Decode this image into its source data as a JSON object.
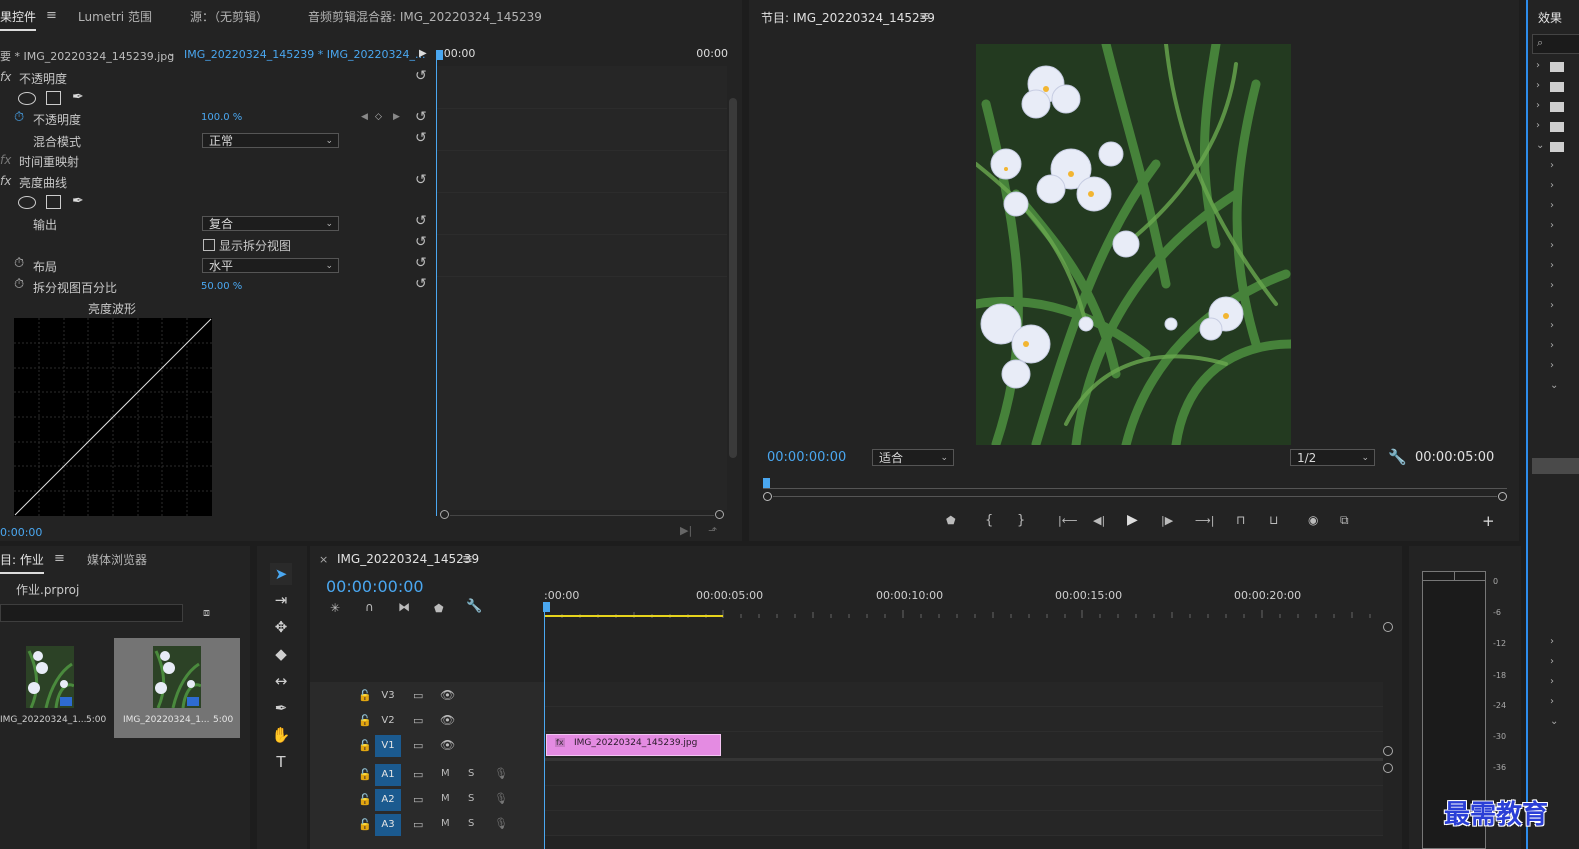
{
  "effect_controls": {
    "tab_effect": "果控件",
    "tab_lumetri": "Lumetri 范围",
    "tab_source": "源：（无剪辑）",
    "tab_audio": "音频剪辑混合器: IMG_20220324_145239",
    "menu_glyph": "≡",
    "master_clip": "要 * IMG_20220324_145239.jpg",
    "seq_clip": "IMG_20220324_145239 * IMG_20220324_...",
    "tc_start": ":00:00",
    "tc_end": "00:00",
    "fx_prefix": "fx",
    "opacity_group": "不透明度",
    "opacity_label": "不透明度",
    "opacity_value": "100.0 %",
    "blend_label": "混合模式",
    "blend_value": "正常",
    "time_remap": "时间重映射",
    "luma_curve": "亮度曲线",
    "output_label": "输出",
    "output_value": "复合",
    "split_view_label": "显示拆分视图",
    "layout_label": "布局",
    "layout_value": "水平",
    "split_pct_label": "拆分视图百分比",
    "split_pct_value": "50.00 %",
    "waveform_label": "亮度波形",
    "bottom_tc": "0:00:00"
  },
  "program_monitor": {
    "title": "节目: IMG_20220324_145239",
    "menu_glyph": "≡",
    "current_tc": "00:00:00:00",
    "fit_value": "适合",
    "res_value": "1/2",
    "duration_tc": "00:00:05:00",
    "photo_colors": {
      "bg": "#2c4226",
      "leaf": "#3f7a35",
      "flower": "#e8ecf7",
      "accent": "#f2b531"
    }
  },
  "effects_panel": {
    "title": "效果",
    "search_icon": "search-icon"
  },
  "project": {
    "tab_project": "目: 作业",
    "tab_media": "媒体浏览器",
    "menu_glyph": "≡",
    "project_file": "作业.prproj",
    "items": [
      {
        "name": "IMG_20220324_1...",
        "duration": "5:00",
        "selected": false
      },
      {
        "name": "IMG_20220324_1...",
        "duration": "5:00",
        "selected": true
      }
    ]
  },
  "timeline": {
    "close": "×",
    "title": "IMG_20220324_145239",
    "menu_glyph": "≡",
    "current_tc": "00:00:00:00",
    "ruler": [
      ":00:00",
      "00:00:05:00",
      "00:00:10:00",
      "00:00:15:00",
      "00:00:20:00"
    ],
    "video_tracks": [
      "V3",
      "V2",
      "V1"
    ],
    "audio_tracks": [
      "A1",
      "A2",
      "A3"
    ],
    "mute": "M",
    "solo": "S",
    "clip_name": "IMG_20220324_145239.jpg",
    "clip_fx": "fx",
    "clip_color": "#e48be2"
  },
  "audio_meter": {
    "labels": [
      "0",
      "-6",
      "-12",
      "-18",
      "-24",
      "-30",
      "-36"
    ]
  },
  "watermark": "最需教育"
}
